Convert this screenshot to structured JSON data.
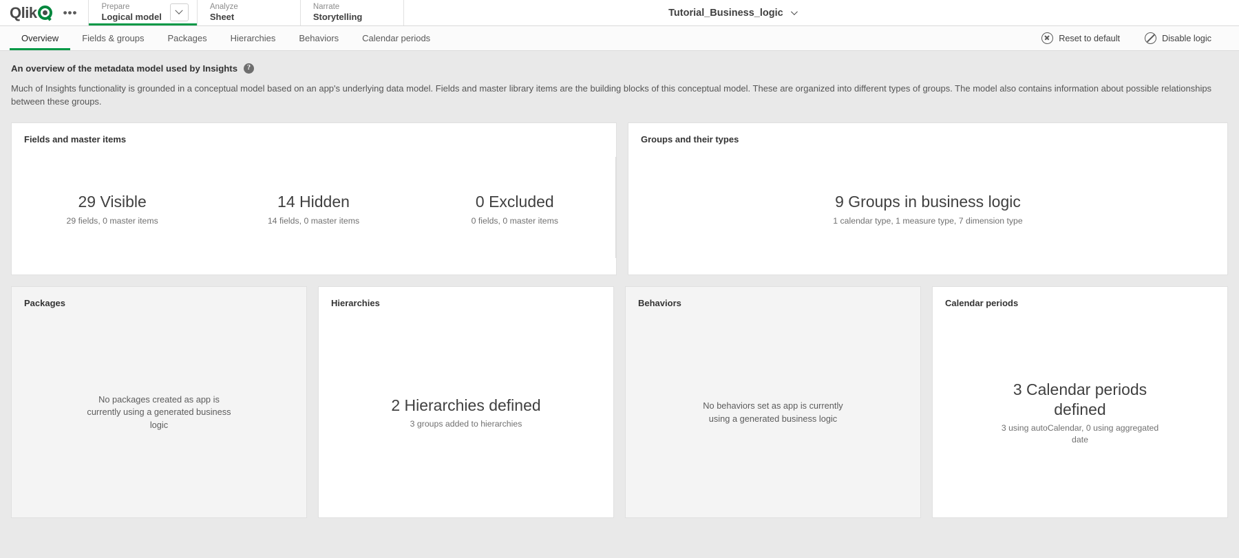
{
  "header": {
    "logo_text": "Qlik",
    "more_label": "•••",
    "sections": [
      {
        "kicker": "Prepare",
        "value": "Logical model",
        "active": true,
        "has_select": true
      },
      {
        "kicker": "Analyze",
        "value": "Sheet",
        "active": false,
        "has_select": false
      },
      {
        "kicker": "Narrate",
        "value": "Storytelling",
        "active": false,
        "has_select": false
      }
    ],
    "app_title": "Tutorial_Business_logic"
  },
  "tabs": [
    {
      "label": "Overview",
      "active": true
    },
    {
      "label": "Fields & groups",
      "active": false
    },
    {
      "label": "Packages",
      "active": false
    },
    {
      "label": "Hierarchies",
      "active": false
    },
    {
      "label": "Behaviors",
      "active": false
    },
    {
      "label": "Calendar periods",
      "active": false
    }
  ],
  "tab_actions": [
    {
      "label": "Reset to default",
      "icon": "reset-circle-x-icon"
    },
    {
      "label": "Disable logic",
      "icon": "no-entry-icon"
    }
  ],
  "intro": {
    "heading": "An overview of the metadata model used by Insights",
    "help_glyph": "?",
    "body": "Much of Insights functionality is grounded in a conceptual model based on an app's underlying data model. Fields and master library items are the building blocks of this conceptual model. These are organized into different types of groups. The model also contains information about possible relationships between these groups."
  },
  "cards": {
    "fields": {
      "title": "Fields and master items",
      "stats": [
        {
          "big": "29 Visible",
          "sub": "29 fields, 0 master items"
        },
        {
          "big": "14 Hidden",
          "sub": "14 fields, 0 master items"
        },
        {
          "big": "0 Excluded",
          "sub": "0 fields, 0 master items"
        }
      ]
    },
    "groups": {
      "title": "Groups and their types",
      "big": "9 Groups in business logic",
      "sub": "1 calendar type, 1 measure type, 7 dimension type"
    },
    "packages": {
      "title": "Packages",
      "empty": "No packages created as app is currently using a generated business logic",
      "muted": true
    },
    "hierarchies": {
      "title": "Hierarchies",
      "big": "2 Hierarchies defined",
      "sub": "3 groups added to hierarchies",
      "muted": false
    },
    "behaviors": {
      "title": "Behaviors",
      "empty": "No behaviors set as app is currently using a generated business logic",
      "muted": true
    },
    "calendar": {
      "title": "Calendar periods",
      "big": "3 Calendar periods defined",
      "sub": "3 using autoCalendar, 0 using aggregated date",
      "muted": false
    }
  },
  "colors": {
    "accent_green": "#009845",
    "logo_green": "#00873d",
    "page_bg": "#e9e9e9",
    "card_bg": "#ffffff",
    "muted_card_bg": "#f4f4f4"
  }
}
